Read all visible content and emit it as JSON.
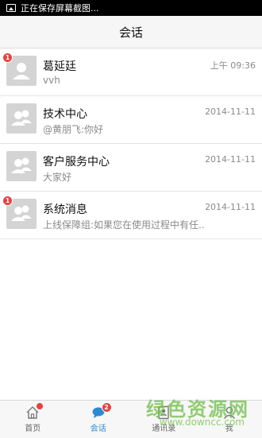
{
  "status_bar": {
    "text": "正在保存屏幕截图..."
  },
  "header": {
    "title": "会话"
  },
  "conversations": [
    {
      "name": "葛延廷",
      "preview": "vvh",
      "time": "上午 09:36",
      "unread": "1",
      "avatar": "person-icon"
    },
    {
      "name": "技术中心",
      "preview": "@黄朋飞:你好",
      "time": "2014-11-11",
      "unread": null,
      "avatar": "group-icon"
    },
    {
      "name": "客户服务中心",
      "preview": "大家好",
      "time": "2014-11-11",
      "unread": null,
      "avatar": "group-icon"
    },
    {
      "name": "系统消息",
      "preview": "上线保障组:如果您在使用过程中有任..",
      "time": "2014-11-11",
      "unread": "1",
      "avatar": "group-icon"
    }
  ],
  "tabs": [
    {
      "label": "首页",
      "icon": "home-icon",
      "active": false,
      "dot": true
    },
    {
      "label": "会话",
      "icon": "chat-icon",
      "active": true,
      "badge": "2"
    },
    {
      "label": "通讯录",
      "icon": "contacts-icon",
      "active": false
    },
    {
      "label": "我",
      "icon": "profile-icon",
      "active": false
    }
  ],
  "watermark": {
    "cn": "绿色资源网",
    "en": "www.downcc.com"
  },
  "colors": {
    "accent": "#2e8bd1",
    "badge": "#e84040",
    "avatar_bg": "#d4d4d4"
  }
}
